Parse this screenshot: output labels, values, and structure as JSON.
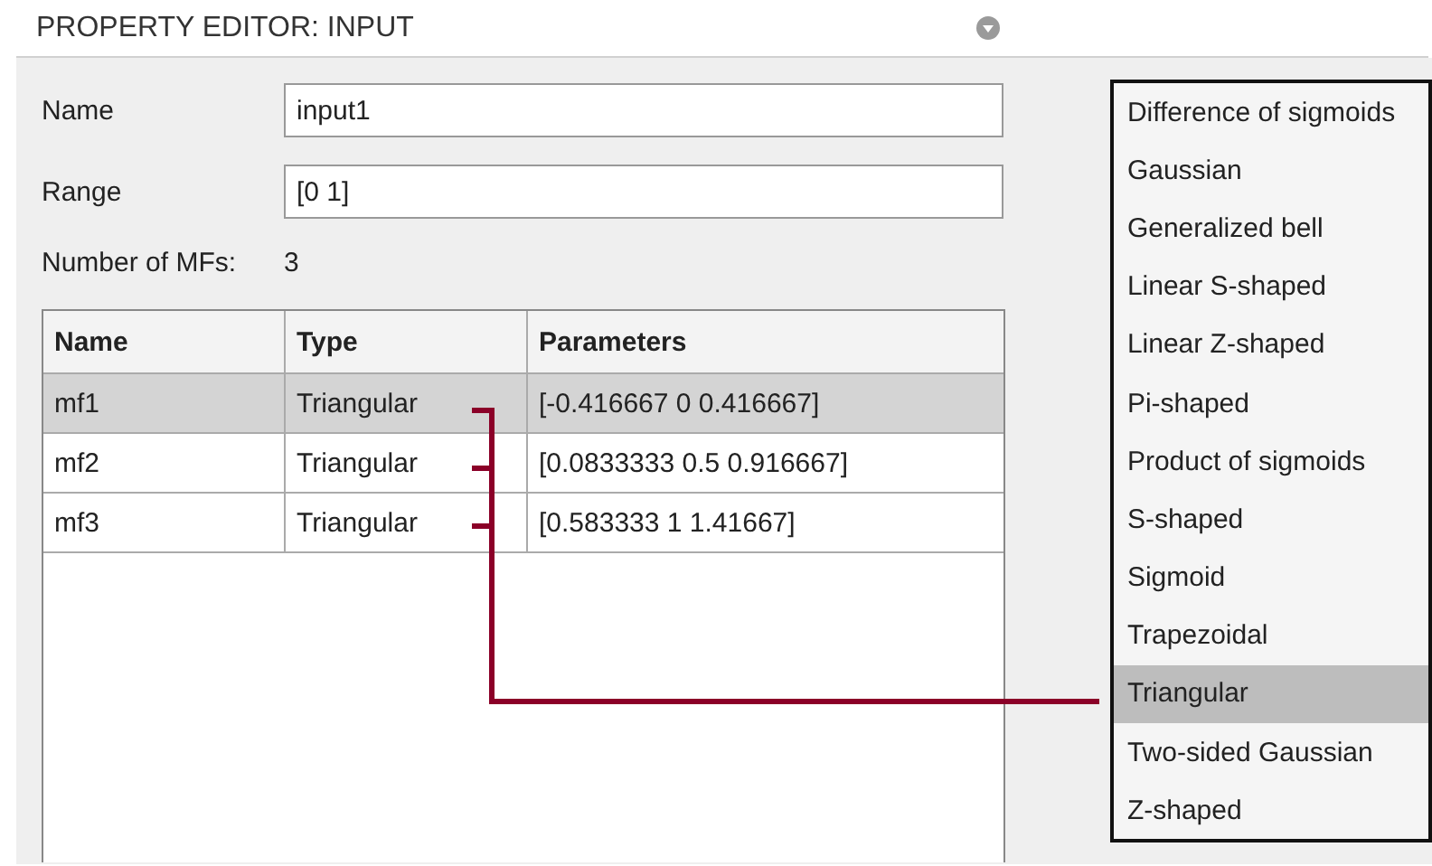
{
  "panel": {
    "title": "PROPERTY EDITOR: INPUT"
  },
  "fields": [
    {
      "label": "Name",
      "value": "input1"
    },
    {
      "label": "Range",
      "value": "[0 1]"
    }
  ],
  "mf_count": {
    "label": "Number of MFs:",
    "value": "3"
  },
  "table": {
    "columns": [
      "Name",
      "Type",
      "Parameters"
    ],
    "rows": [
      {
        "cells": [
          "mf1",
          "Triangular",
          "[-0.416667 0 0.416667]"
        ],
        "selected": true
      },
      {
        "cells": [
          "mf2",
          "Triangular",
          "[0.0833333 0.5 0.916667]"
        ],
        "selected": false
      },
      {
        "cells": [
          "mf3",
          "Triangular",
          "[0.583333 1 1.41667]"
        ],
        "selected": false
      }
    ]
  },
  "type_list": {
    "items": [
      {
        "label": "Difference of sigmoids",
        "selected": false
      },
      {
        "label": "Gaussian",
        "selected": false
      },
      {
        "label": "Generalized bell",
        "selected": false
      },
      {
        "label": "Linear S-shaped",
        "selected": false
      },
      {
        "label": "Linear Z-shaped",
        "selected": false
      },
      {
        "label": "Pi-shaped",
        "selected": false
      },
      {
        "label": "Product of sigmoids",
        "selected": false
      },
      {
        "label": "S-shaped",
        "selected": false
      },
      {
        "label": "Sigmoid",
        "selected": false
      },
      {
        "label": "Trapezoidal",
        "selected": false
      },
      {
        "label": "Triangular",
        "selected": true
      },
      {
        "label": "Two-sided Gaussian",
        "selected": false
      },
      {
        "label": "Z-shaped",
        "selected": false
      }
    ]
  }
}
